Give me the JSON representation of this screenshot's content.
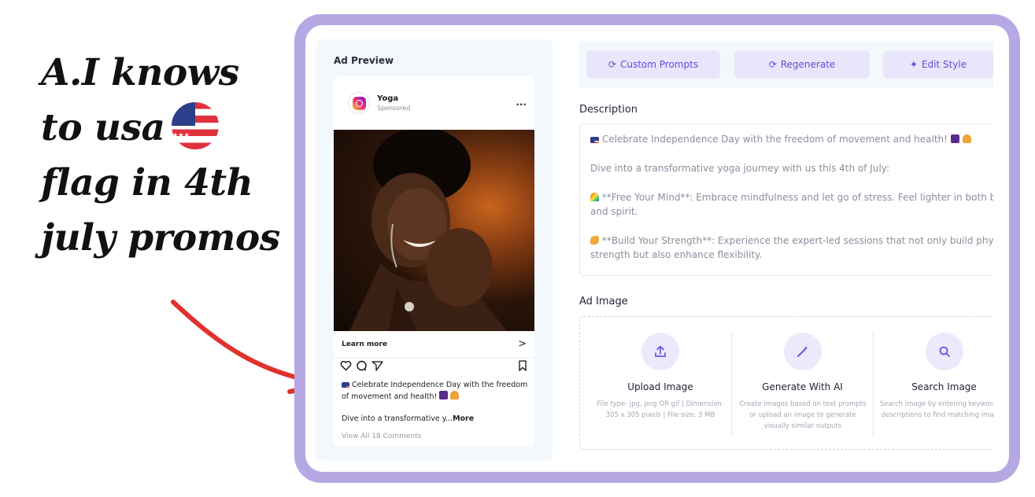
{
  "annotation": {
    "lines": [
      "A.I knows",
      "to usa",
      "flag in 4th",
      "july promos"
    ]
  },
  "ad_preview": {
    "title": "Ad Preview",
    "brand": "Yoga",
    "sponsored": "Sponsored",
    "more_menu": "...",
    "learn_more": "Learn more",
    "learn_more_chevron": ">",
    "caption_line1": "Celebrate Independence Day with the freedom",
    "caption_line2": "of movement and health!",
    "caption_preview": "Dive into a transformative y...",
    "more_link": "More",
    "comments_link": "View All 18 Comments"
  },
  "toolbar": {
    "custom_prompts": "Custom Prompts",
    "regenerate": "Regenerate",
    "edit_style": "Edit Style"
  },
  "description": {
    "label": "Description",
    "p1": "Celebrate Independence Day with the freedom of movement and health!",
    "p2": "Dive into a transformative yoga journey with us this 4th of July:",
    "p3": "**Free Your Mind**: Embrace mindfulness and let go of stress. Feel lighter in both body and spirit.",
    "p4": "**Build Your Strength**: Experience the expert-led sessions that not only build physical strength but also enhance flexibility."
  },
  "ad_image": {
    "label": "Ad Image",
    "upload_title": "Upload Image",
    "upload_desc": "File type: jpg, png OR gif | Dimension: 305 x 305 pixels | File size: 3 MB",
    "generate_title": "Generate With AI",
    "generate_desc": "Create images based on text prompts or upload an image to generate visually similar outputs",
    "search_title": "Search Image",
    "search_desc": "Search image by entering keywords or descriptions to find matching images."
  },
  "colors": {
    "frame": "#b5a8e3",
    "accent": "#5f4bd6",
    "button_bg": "#e9e6fb",
    "arrow": "#e0312d"
  }
}
